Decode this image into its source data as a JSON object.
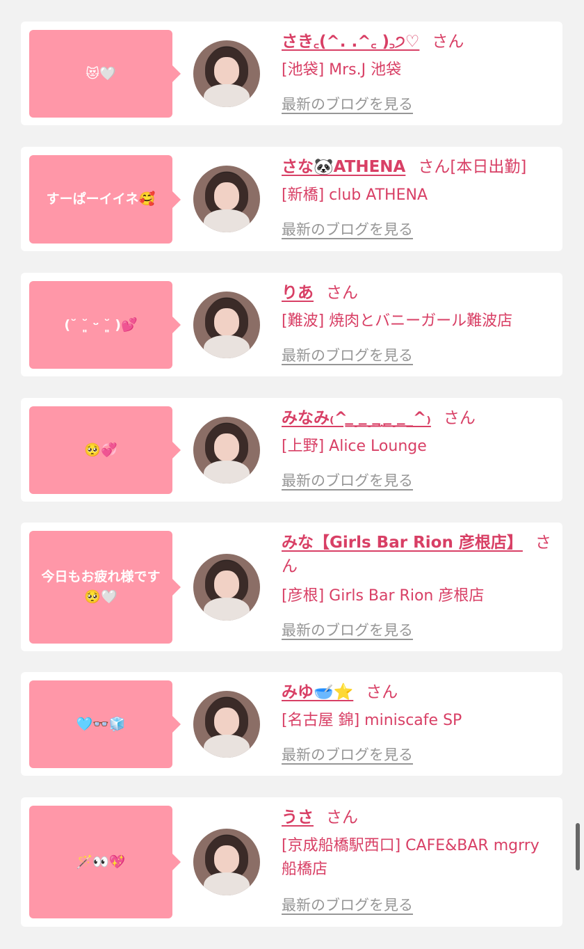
{
  "cards": [
    {
      "comment": "😻🤍",
      "name": "さき꜀(^. .^꜀ )꜆੭♡",
      "honorific": "さん",
      "extra": "",
      "shop": "[池袋] Mrs.J 池袋",
      "blog_link": "最新のブログを見る"
    },
    {
      "comment": "すーぱーイイネ🥰",
      "name": "さな🐼ATHENA",
      "honorific": "さん",
      "extra": "[本日出勤]",
      "shop": "[新橋] club ATHENA",
      "blog_link": "最新のブログを見る"
    },
    {
      "comment": "(˘ ˘͈ ᵕ ˘͈ )💕",
      "name": "りあ",
      "honorific": "さん",
      "extra": "",
      "shop": "[難波] 焼肉とバニーガール難波店",
      "blog_link": "最新のブログを見る"
    },
    {
      "comment": "🥺💞",
      "name": "みなみ₍^ ̳_ ̳_ ̳ ̫ ̳_ ̳_^₎",
      "honorific": "さん",
      "extra": "",
      "shop": "[上野] Alice Lounge",
      "blog_link": "最新のブログを見る"
    },
    {
      "comment": "今日もお疲れ様です🥺🤍",
      "name": "みな【Girls Bar Rion 彦根店】",
      "honorific": "さん",
      "extra": "",
      "shop": "[彦根] Girls Bar Rion 彦根店",
      "blog_link": "最新のブログを見る"
    },
    {
      "comment": "🩵👓🧊",
      "name": "みゆ🥣⭐",
      "honorific": "さん",
      "extra": "",
      "shop": "[名古屋 錦] miniscafe SP",
      "blog_link": "最新のブログを見る"
    },
    {
      "comment": "🪄👀💖",
      "name": "うさ",
      "honorific": "さん",
      "extra": "",
      "shop": "[京成船橋駅西口] CAFE&BAR mgrry 船橋店",
      "blog_link": "最新のブログを見る"
    }
  ],
  "colors": {
    "background": "#f2f2f2",
    "card": "#ffffff",
    "bubble": "#ff97a8",
    "accent": "#d83f65",
    "muted": "#969696"
  }
}
